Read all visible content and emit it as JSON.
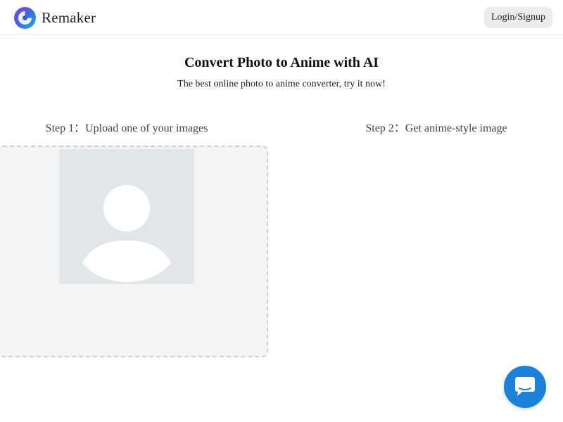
{
  "header": {
    "logo_text": "Remaker",
    "login_label": "Login/Signup"
  },
  "main": {
    "title": "Convert Photo to Anime with AI",
    "subtitle": "The best online photo to anime converter, try it now!",
    "step1_label": "Step 1：Upload one of your images",
    "step2_label": "Step 2：Get anime-style image"
  },
  "upload": {
    "placeholder_icon": "user-silhouette-icon"
  },
  "chat": {
    "icon": "chat-bubble-icon"
  },
  "colors": {
    "accent": "#1a82d8",
    "login_bg": "#ececec",
    "upload_bg": "#f4f4f5",
    "placeholder_bg": "#e1e6e9"
  }
}
